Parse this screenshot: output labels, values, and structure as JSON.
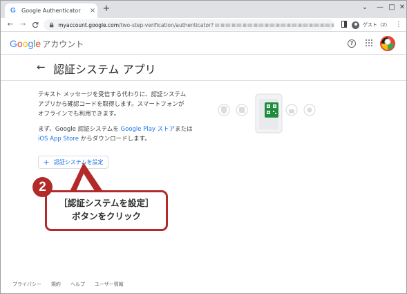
{
  "browser": {
    "tab_icon": "G",
    "tab_title": "Google Authenticator",
    "tab_close": "×",
    "new_tab": "+",
    "window_controls": {
      "minimize": "—",
      "maximize": "□",
      "close": "✕"
    },
    "nav": {
      "back": "←",
      "forward": "→",
      "reload": "C"
    },
    "url_host": "myaccount.google.com",
    "url_path": "/two-step-verification/authenticator?",
    "profile_label": "ゲスト（2）",
    "menu": "⋮"
  },
  "account_header": {
    "logo_letters": [
      {
        "ch": "G",
        "color": "#4285f4"
      },
      {
        "ch": "o",
        "color": "#ea4335"
      },
      {
        "ch": "o",
        "color": "#fbbc04"
      },
      {
        "ch": "g",
        "color": "#4285f4"
      },
      {
        "ch": "l",
        "color": "#34a853"
      },
      {
        "ch": "e",
        "color": "#ea4335"
      }
    ],
    "account_label": "アカウント",
    "help_icon": "?"
  },
  "page": {
    "back": "←",
    "title": "認証システム アプリ",
    "description_lines": [
      "テキスト メッセージを受信する代わりに、認証システム",
      "アプリから確認コードを取得します。スマートフォンが",
      "オフラインでも利用できます。"
    ],
    "install_prefix": "まず、Google 認証システムを ",
    "google_play_link": "Google Play ストア",
    "install_middle": "または",
    "app_store_link": "iOS App Store",
    "install_suffix": " からダウンロードします。",
    "setup_button_icon": "+",
    "setup_button_label": "認証システムを設定"
  },
  "callout": {
    "step_number": "2",
    "line1": "［認証システムを設定］",
    "line2": "ボタンをクリック",
    "color": "#b32a2a"
  },
  "footer": {
    "links": [
      "プライバシー",
      "規約",
      "ヘルプ",
      "ユーザー情報"
    ]
  }
}
